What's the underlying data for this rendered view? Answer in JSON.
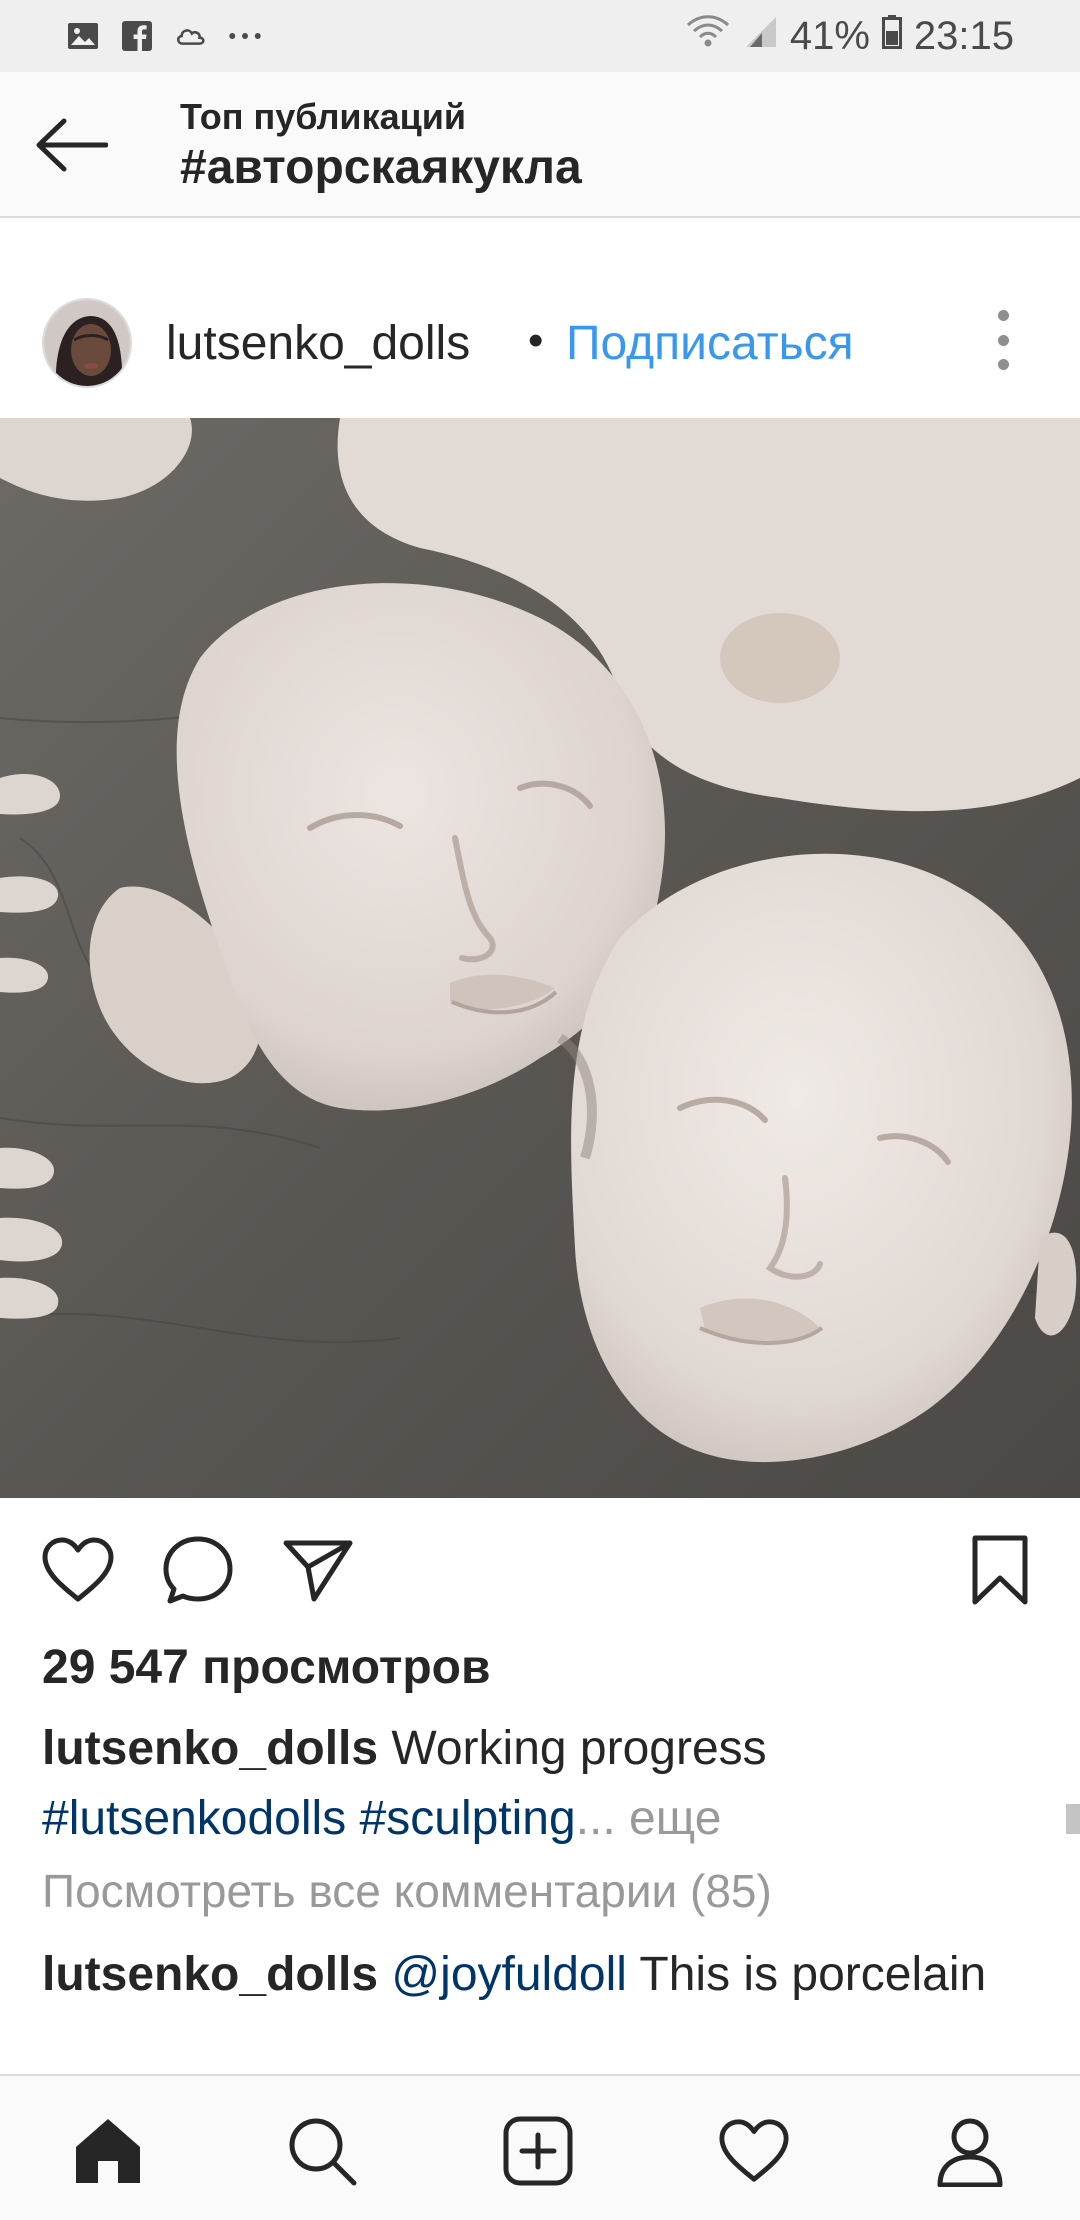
{
  "status_bar": {
    "left_icons": [
      "image-icon",
      "facebook-icon",
      "cloud-sync-icon",
      "more-dots-icon"
    ],
    "battery": "41%",
    "time": "23:15"
  },
  "header": {
    "subtitle": "Топ публикаций",
    "title": "#авторскаякукла"
  },
  "post": {
    "username": "lutsenko_dolls",
    "separator": "•",
    "follow_label": "Подписаться",
    "views": "29 547 просмотров",
    "caption": {
      "username": "lutsenko_dolls",
      "text": "Working progress",
      "tag1": "#lutsenkodolls",
      "tag2": "#sculpting",
      "ellipsis": "...",
      "more": "еще"
    },
    "view_all_comments": "Посмотреть все комментарии (85)",
    "comment": {
      "username": "lutsenko_dolls",
      "mention": "@joyfuldoll",
      "text": "This is porcelain"
    }
  },
  "bottom_nav": {
    "items": [
      "home-icon",
      "search-icon",
      "add-post-icon",
      "activity-heart-icon",
      "profile-icon"
    ]
  },
  "colors": {
    "link_blue": "#3897f0",
    "hashtag": "#003569",
    "muted": "#999999",
    "text": "#262626"
  }
}
